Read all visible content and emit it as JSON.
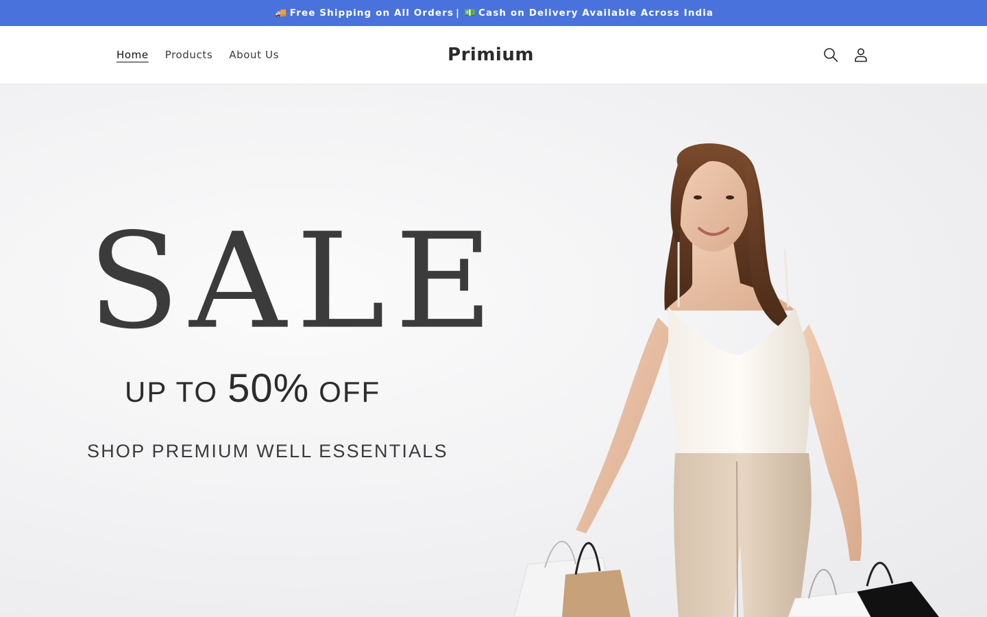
{
  "announcement": {
    "part1": "Free Shipping on All Orders",
    "separator": "|",
    "part2": "Cash on Delivery Available Across India",
    "icon1": "truck-icon",
    "icon2": "cash-icon",
    "background_color": "#4a72dc"
  },
  "header": {
    "nav": [
      {
        "label": "Home",
        "active": true
      },
      {
        "label": "Products",
        "active": false
      },
      {
        "label": "About Us",
        "active": false
      }
    ],
    "logo": "Primium",
    "icons": [
      "search-icon",
      "account-icon"
    ]
  },
  "hero": {
    "headline": "SALE",
    "offer_prefix": "UP TO",
    "offer_value": "50%",
    "offer_suffix": "OFF",
    "tagline": "SHOP PREMIUM WELL ESSENTIALS"
  }
}
